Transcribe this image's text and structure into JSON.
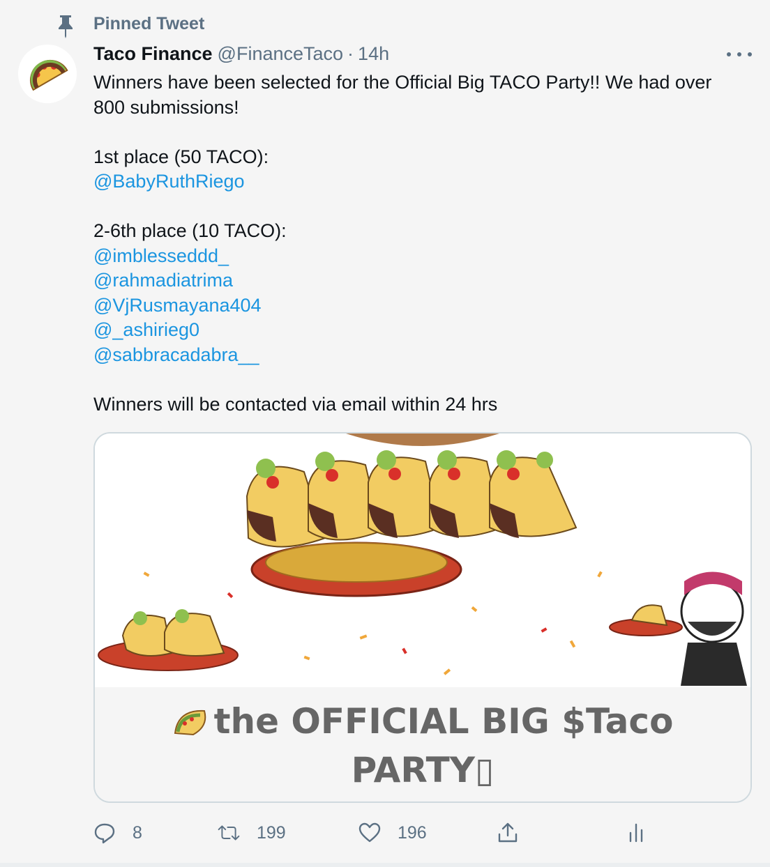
{
  "pinned": {
    "label": "Pinned Tweet",
    "icon": "pin-icon"
  },
  "author": {
    "display_name": "Taco Finance",
    "handle": "@FinanceTaco",
    "separator": "·",
    "time": "14h",
    "avatar_icon": "taco-avatar"
  },
  "more_icon": "more-icon",
  "tweet": {
    "lines": [
      {
        "text": "Winners have been selected for the Official Big TACO Party!! We had over",
        "mention": false
      },
      {
        "text": "800 submissions!",
        "mention": false
      },
      {
        "text": "",
        "mention": false
      },
      {
        "text": "1st place (50 TACO):",
        "mention": false
      },
      {
        "text": "@BabyRuthRiego",
        "mention": true
      },
      {
        "text": "",
        "mention": false
      },
      {
        "text": "2-6th place (10 TACO):",
        "mention": false
      },
      {
        "text": "@imblesseddd_",
        "mention": true
      },
      {
        "text": "@rahmadiatrima",
        "mention": true
      },
      {
        "text": "@VjRusmayana404",
        "mention": true
      },
      {
        "text": "@_ashirieg0",
        "mention": true
      },
      {
        "text": "@sabbracadabra__",
        "mention": true
      },
      {
        "text": "",
        "mention": false
      },
      {
        "text": "Winners will be contacted via email within 24 hrs",
        "mention": false
      }
    ]
  },
  "card": {
    "caption_line1": "the OFFICIAL BIG $Taco",
    "caption_line2": "PARTY▯",
    "image_icon": "taco-party-illustration"
  },
  "actions": {
    "reply": {
      "icon": "reply-icon",
      "count": "8"
    },
    "retweet": {
      "icon": "retweet-icon",
      "count": "199"
    },
    "like": {
      "icon": "heart-icon",
      "count": "196"
    },
    "share": {
      "icon": "share-icon"
    },
    "analytics": {
      "icon": "analytics-icon"
    }
  },
  "colors": {
    "link": "#1b95e0",
    "muted": "#5b7083",
    "text": "#0f1419"
  }
}
